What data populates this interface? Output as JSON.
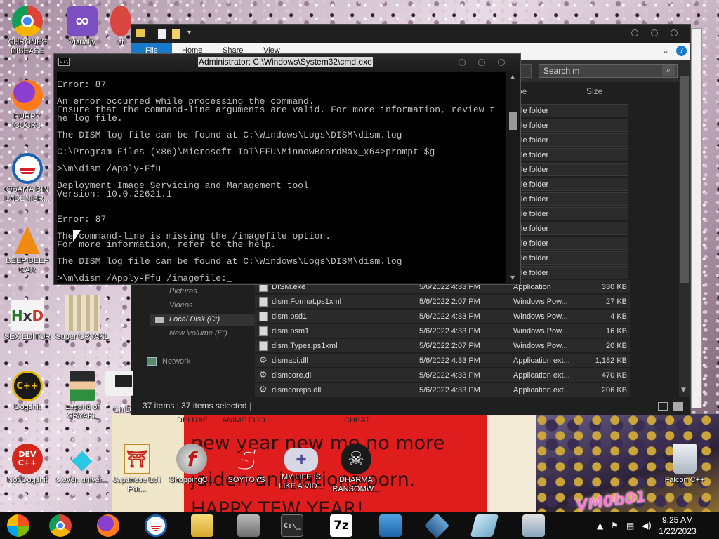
{
  "desktop": {
    "icons": [
      {
        "label": "CHRONES DISEASE",
        "icon": "chrome-icon"
      },
      {
        "label": "Visually",
        "icon": "visual-studio-icon"
      },
      {
        "label": "FURRY CUCKS",
        "icon": "firefox-icon"
      },
      {
        "label": "OSAMA BIN LADEN BR...",
        "icon": "obama-logo-icon"
      },
      {
        "label": "BEEP BEEP CAR",
        "icon": "vlc-cone-icon"
      },
      {
        "label": "SEX EDITOR",
        "icon": "hxd-icon"
      },
      {
        "label": "Super CRYAKL",
        "icon": "pixel-character-icon"
      },
      {
        "label": "Dogshit",
        "icon": "cpp-icon"
      },
      {
        "label": "Legend of CRYAKL",
        "icon": "pixel-character-icon"
      },
      {
        "label": "Not Dogshit",
        "icon": "dev-cpp-icon"
      },
      {
        "label": "steven univer...",
        "icon": "diamond-icon"
      },
      {
        "label": "Japanese Loli Por...",
        "icon": "torii-gate-icon"
      },
      {
        "label": "ShoppingC...",
        "icon": "flash-icon"
      },
      {
        "label": "SOYTOYS",
        "icon": "s-logo-icon"
      },
      {
        "label": "MY LIFE IS LIKE A VID...",
        "icon": "gamepad-icon"
      },
      {
        "label": "DHARMA RANSOMW...",
        "icon": "skull-icon"
      },
      {
        "label": "Falcon C++",
        "icon": "recycle-bin-icon"
      }
    ],
    "partial_labels": [
      "st",
      "Ch Droue",
      "DELUXE",
      "ANIME FOO...",
      "CHEAT"
    ],
    "wallpaper_text": [
      "new year new me no more",
      "jaiden animations porn.",
      "HAPPY TEW YEAR!",
      "VM0b01"
    ]
  },
  "explorer": {
    "ribbon_tabs": [
      "File",
      "Home",
      "Share",
      "View"
    ],
    "search_placeholder": "Search m",
    "column_type": "pe",
    "column_size": "Size",
    "folder_label": "le folder",
    "folder_count": 12,
    "nav": [
      {
        "label": "Pictures"
      },
      {
        "label": "Videos"
      },
      {
        "label": "Local Disk (C:)"
      },
      {
        "label": "New Volume (E:)"
      },
      {
        "label": "Network"
      }
    ],
    "files": [
      {
        "name": "DISM.exe",
        "date": "5/6/2022 4:33 PM",
        "type": "Application",
        "size": "330 KB",
        "icon": "file-icon"
      },
      {
        "name": "dism.Format.ps1xml",
        "date": "5/6/2022 2:07 PM",
        "type": "Windows Pow...",
        "size": "27 KB",
        "icon": "file-icon"
      },
      {
        "name": "dism.psd1",
        "date": "5/6/2022 4:33 PM",
        "type": "Windows Pow...",
        "size": "4 KB",
        "icon": "file-icon"
      },
      {
        "name": "dism.psm1",
        "date": "5/6/2022 4:33 PM",
        "type": "Windows Pow...",
        "size": "16 KB",
        "icon": "file-icon"
      },
      {
        "name": "dism.Types.ps1xml",
        "date": "5/6/2022 2:07 PM",
        "type": "Windows Pow...",
        "size": "20 KB",
        "icon": "file-icon"
      },
      {
        "name": "dismapi.dll",
        "date": "5/6/2022 4:33 PM",
        "type": "Application ext...",
        "size": "1,182 KB",
        "icon": "gear-icon"
      },
      {
        "name": "dismcore.dll",
        "date": "5/6/2022 4:33 PM",
        "type": "Application ext...",
        "size": "470 KB",
        "icon": "gear-icon"
      },
      {
        "name": "dismcoreps.dll",
        "date": "5/6/2022 4:33 PM",
        "type": "Application ext...",
        "size": "206 KB",
        "icon": "gear-icon"
      }
    ],
    "status": {
      "items": "37 items",
      "selected": "37 items selected"
    }
  },
  "cmd": {
    "title": "Administrator: C:\\Windows\\System32\\cmd.exe",
    "lines": [
      "Error: 87",
      "",
      "An error occurred while processing the command.",
      "Ensure that the command-line arguments are valid. For more information, review t",
      "he log file.",
      "",
      "The DISM log file can be found at C:\\Windows\\Logs\\DISM\\dism.log",
      "",
      "C:\\Program Files (x86)\\Microsoft IoT\\FFU\\MinnowBoardMax_x64>prompt $g",
      "",
      ">\\m\\dism /Apply-Ffu",
      "",
      "Deployment Image Servicing and Management tool",
      "Version: 10.0.22621.1",
      "",
      "",
      "Error: 87",
      "",
      "The command-line is missing the /imagefile option.",
      "For more information, refer to the help.",
      "",
      "The DISM log file can be found at C:\\Windows\\Logs\\DISM\\dism.log",
      "",
      ">\\m\\dism /Apply-Ffu /imagefile:_"
    ]
  },
  "taskbar": {
    "apps": [
      "start-button",
      "chrome-icon",
      "firefox-icon",
      "obama-logo-icon",
      "file-explorer-icon",
      "package-icon",
      "cmd-icon",
      "7zip-icon",
      "control-panel-icon",
      "virtualbox-icon",
      "paint-icon",
      "network-icon"
    ],
    "sevenzip_label": "7z",
    "time": "9:25 AM",
    "date": "1/22/2023"
  }
}
